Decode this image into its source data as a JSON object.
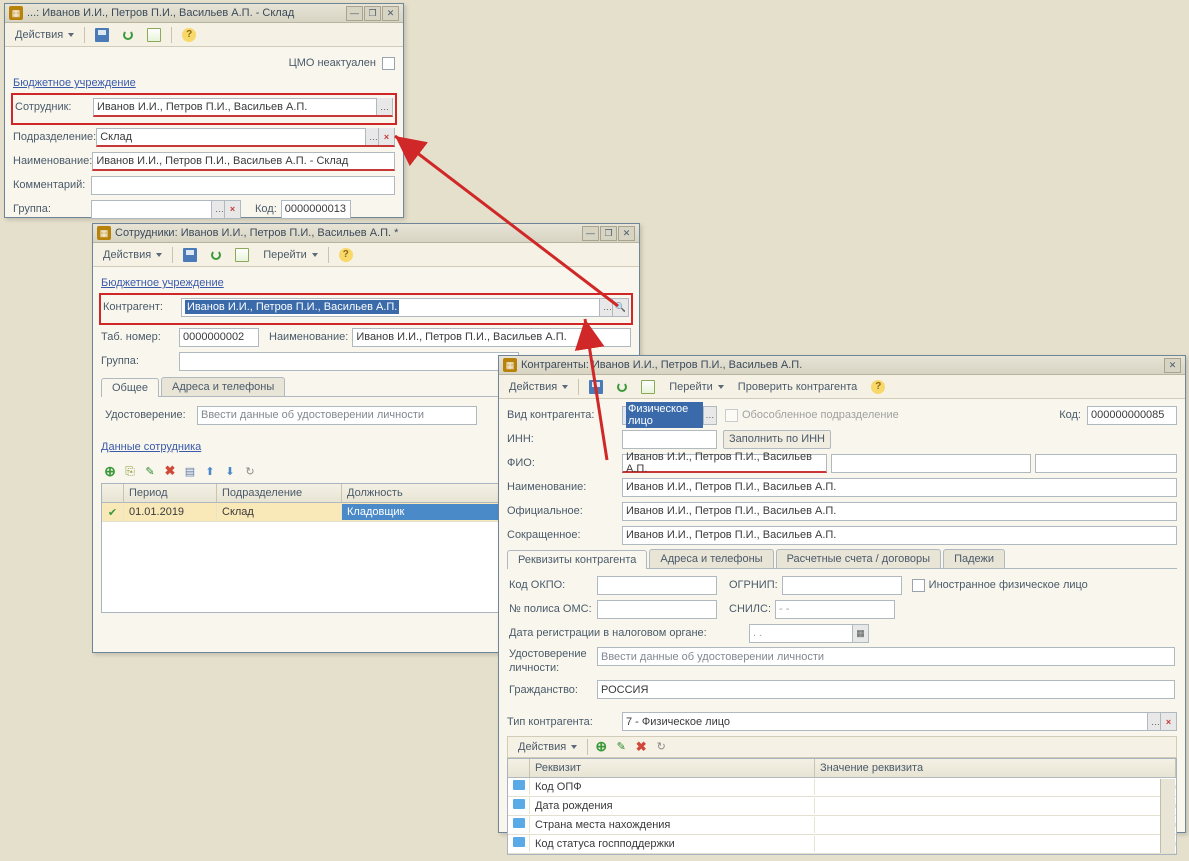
{
  "win1": {
    "title": "...: Иванов И.И., Петров П.И., Васильев А.П. - Склад",
    "actions": "Действия",
    "cmo_label": "ЦМО неактуален",
    "section": "Бюджетное учреждение",
    "employee_lbl": "Сотрудник:",
    "employee_val": "Иванов И.И., Петров П.И., Васильев А.П.",
    "dept_lbl": "Подразделение:",
    "dept_val": "Склад",
    "name_lbl": "Наименование:",
    "name_val": "Иванов И.И., Петров П.И., Васильев А.П. - Склад",
    "comment_lbl": "Комментарий:",
    "group_lbl": "Группа:",
    "code_lbl": "Код:",
    "code_val": "0000000013"
  },
  "win2": {
    "title": "Сотрудники: Иванов И.И., Петров П.И., Васильев А.П. *",
    "actions": "Действия",
    "goto": "Перейти",
    "section": "Бюджетное учреждение",
    "contragent_lbl": "Контрагент:",
    "contragent_val": "Иванов И.И., Петров П.И., Васильев А.П.",
    "tabnum_lbl": "Таб. номер:",
    "tabnum_val": "0000000002",
    "name_lbl": "Наименование:",
    "name_val": "Иванов И.И., Петров П.И., Васильев А.П.",
    "group_lbl": "Группа:",
    "tab_general": "Общее",
    "tab_addr": "Адреса и телефоны",
    "ident_lbl": "Удостоверение:",
    "ident_val": "Ввести данные об удостоверении личности",
    "empdata_hdr": "Данные сотрудника",
    "col_period": "Период",
    "col_dept": "Подразделение",
    "col_pos": "Должность",
    "row_date": "01.01.2019",
    "row_dept": "Склад",
    "row_pos": "Кладовщик"
  },
  "win3": {
    "title": "Контрагенты: Иванов И.И., Петров П.И., Васильев А.П.",
    "actions": "Действия",
    "goto": "Перейти",
    "check": "Проверить контрагента",
    "type_lbl": "Вид контрагента:",
    "type_val": "Физическое лицо",
    "separate_lbl": "Обособленное подразделение",
    "code_lbl": "Код:",
    "code_val": "000000000085",
    "inn_lbl": "ИНН:",
    "fill_inn": "Заполнить по ИНН",
    "fio_lbl": "ФИО:",
    "fio_val": "Иванов И.И., Петров П.И., Васильев А.П.",
    "name_lbl": "Наименование:",
    "name_val": "Иванов И.И., Петров П.И., Васильев А.П.",
    "official_lbl": "Официальное:",
    "official_val": "Иванов И.И., Петров П.И., Васильев А.П.",
    "short_lbl": "Сокращенное:",
    "short_val": "Иванов И.И., Петров П.И., Васильев А.П.",
    "tab_req": "Реквизиты контрагента",
    "tab_addr": "Адреса и телефоны",
    "tab_acc": "Расчетные счета / договоры",
    "tab_cases": "Падежи",
    "okpo_lbl": "Код ОКПО:",
    "ogrnip_lbl": "ОГРНИП:",
    "foreign_lbl": "Иностранное физическое лицо",
    "oms_lbl": "№ полиса ОМС:",
    "snils_lbl": "СНИЛС:",
    "snils_val": "   -   -",
    "regdate_lbl": "Дата регистрации в налоговом органе:",
    "regdate_val": "  .  .",
    "ident_lbl": "Удостоверение личности:",
    "ident_val": "Ввести данные об удостоверении личности",
    "citizen_lbl": "Гражданство:",
    "citizen_val": "РОССИЯ",
    "ctype_lbl": "Тип контрагента:",
    "ctype_val": "7 - Физическое лицо",
    "sub_actions": "Действия",
    "col_req": "Реквизит",
    "col_val": "Значение реквизита",
    "r1": "Код ОПФ",
    "r2": "Дата рождения",
    "r3": "Страна места нахождения",
    "r4": "Код статуса госпподдержки"
  }
}
